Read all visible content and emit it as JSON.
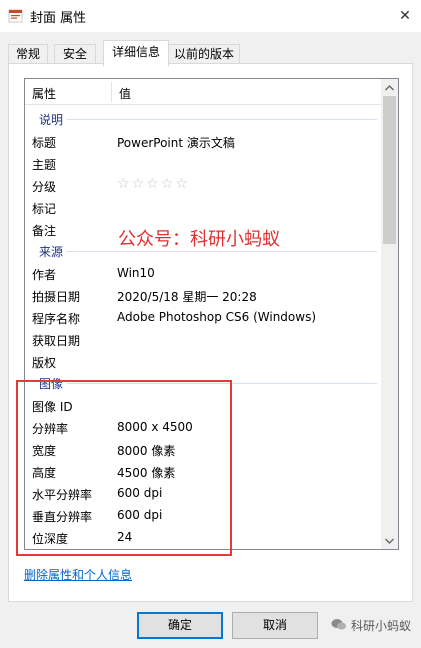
{
  "window": {
    "title": "封面 属性",
    "close_glyph": "✕"
  },
  "tabs": [
    {
      "label": "常规"
    },
    {
      "label": "安全"
    },
    {
      "label": "详细信息"
    },
    {
      "label": "以前的版本"
    }
  ],
  "list": {
    "header": {
      "name": "属性",
      "value": "值"
    },
    "sections": [
      {
        "title": "说明",
        "rows": [
          {
            "name": "标题",
            "value": "PowerPoint 演示文稿"
          },
          {
            "name": "主题",
            "value": ""
          },
          {
            "name": "分级",
            "value": "☆☆☆☆☆"
          },
          {
            "name": "标记",
            "value": ""
          },
          {
            "name": "备注",
            "value": ""
          }
        ]
      },
      {
        "title": "来源",
        "rows": [
          {
            "name": "作者",
            "value": "Win10"
          },
          {
            "name": "拍摄日期",
            "value": "2020/5/18 星期一 20:28"
          },
          {
            "name": "程序名称",
            "value": "Adobe Photoshop CS6 (Windows)"
          },
          {
            "name": "获取日期",
            "value": ""
          },
          {
            "name": "版权",
            "value": ""
          }
        ]
      },
      {
        "title": "图像",
        "rows": [
          {
            "name": "图像 ID",
            "value": ""
          },
          {
            "name": "分辨率",
            "value": "8000 x 4500"
          },
          {
            "name": "宽度",
            "value": "8000 像素"
          },
          {
            "name": "高度",
            "value": "4500 像素"
          },
          {
            "name": "水平分辨率",
            "value": "600 dpi"
          },
          {
            "name": "垂直分辨率",
            "value": "600 dpi"
          },
          {
            "name": "位深度",
            "value": "24"
          }
        ]
      }
    ]
  },
  "watermark": "公众号：科研小蚂蚁",
  "remove_link": "删除属性和个人信息",
  "buttons": {
    "ok": "确定",
    "cancel": "取消"
  },
  "wechat_watermark": "科研小蚂蚁"
}
